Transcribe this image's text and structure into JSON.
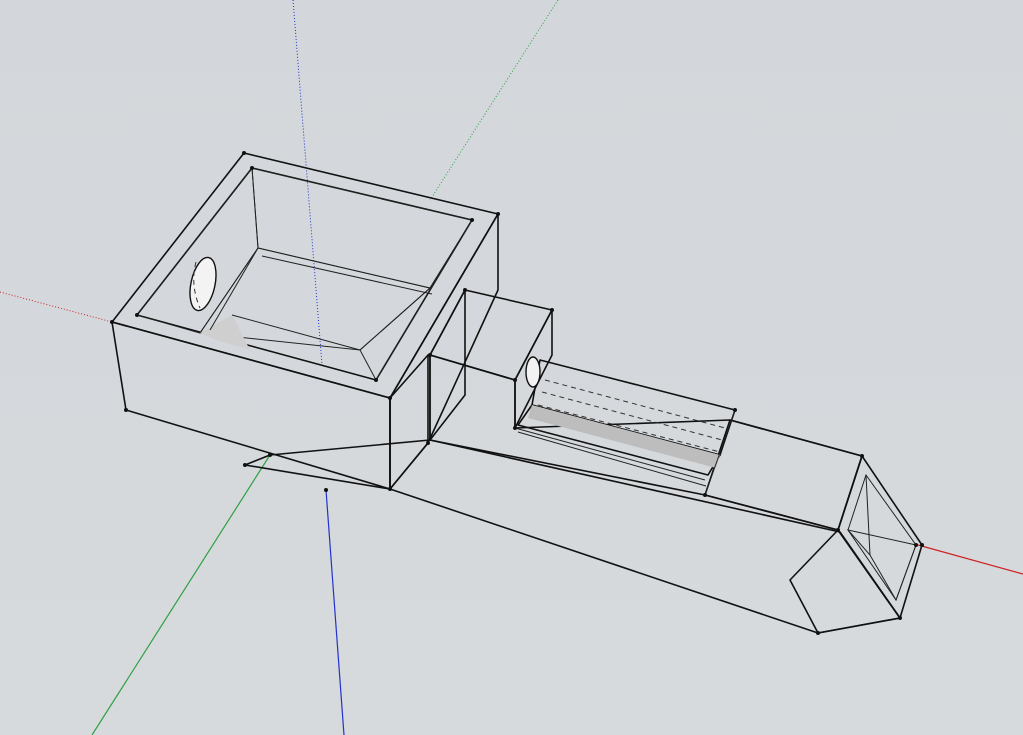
{
  "viewport": {
    "background_color": "#d5d9dd",
    "axis_colors": {
      "red": "#cc2222",
      "green": "#2ea043",
      "blue": "#2233cc"
    },
    "face_colors": {
      "light": "#ececec",
      "mid": "#dcdcdc",
      "shade": "#a9a9a9",
      "dark": "#8d8d8d"
    }
  },
  "model": {
    "components": [
      "open-box-hopper",
      "side-hole-left",
      "inner-sloped-wall",
      "neck-block",
      "neck-hole",
      "channel-slot",
      "long-body",
      "square-nozzle-opening"
    ]
  }
}
